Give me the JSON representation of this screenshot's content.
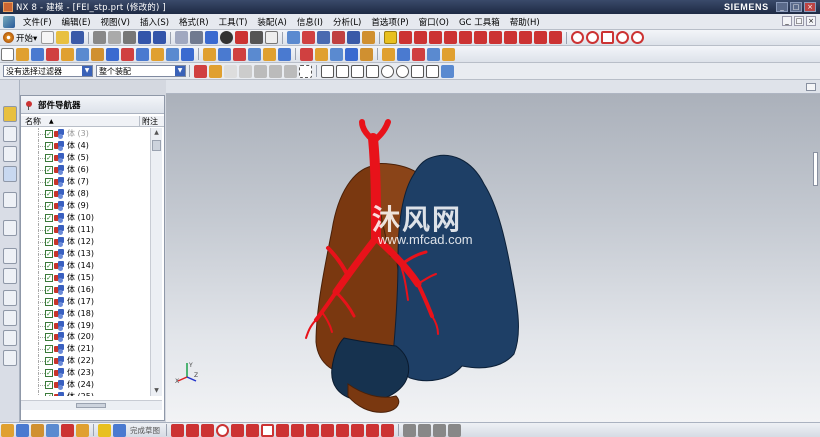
{
  "window": {
    "app_title": "NX 8 - 建模 - [FEI_stp.prt   (修改的) ]",
    "brand": "SIEMENS",
    "controls": [
      "_",
      "□",
      "×"
    ]
  },
  "menu": {
    "items": [
      "文件(F)",
      "编辑(E)",
      "视图(V)",
      "插入(S)",
      "格式(R)",
      "工具(T)",
      "装配(A)",
      "信息(I)",
      "分析(L)",
      "首选项(P)",
      "窗口(O)",
      "GC 工具箱",
      "帮助(H)"
    ],
    "right_controls": [
      "_",
      "□",
      "×"
    ]
  },
  "toolbar": {
    "start_label": "开始▾",
    "selection_filter": "没有选择过滤器",
    "assembly_scope": "整个装配",
    "status_hint": "完成草图"
  },
  "navigator": {
    "title": "部件导航器",
    "columns": {
      "name": "名称",
      "extra": "附注"
    },
    "rows": [
      {
        "label": "体 (3)",
        "dim": true
      },
      {
        "label": "体 (4)"
      },
      {
        "label": "体 (5)"
      },
      {
        "label": "体 (6)"
      },
      {
        "label": "体 (7)"
      },
      {
        "label": "体 (8)"
      },
      {
        "label": "体 (9)"
      },
      {
        "label": "体 (10)"
      },
      {
        "label": "体 (11)"
      },
      {
        "label": "体 (12)"
      },
      {
        "label": "体 (13)"
      },
      {
        "label": "体 (14)"
      },
      {
        "label": "体 (15)"
      },
      {
        "label": "体 (16)"
      },
      {
        "label": "体 (17)"
      },
      {
        "label": "体 (18)"
      },
      {
        "label": "体 (19)"
      },
      {
        "label": "体 (20)"
      },
      {
        "label": "体 (21)"
      },
      {
        "label": "体 (22)"
      },
      {
        "label": "体 (23)"
      },
      {
        "label": "体 (24)"
      },
      {
        "label": "体 (25)"
      }
    ]
  },
  "watermark": {
    "text": "沐风网",
    "url": "www.mfcad.com"
  },
  "colors": {
    "trachea": "#e8121a",
    "left_lung": "#7a3810",
    "right_lung": "#1e3f66"
  },
  "triad": {
    "x": "X",
    "y": "Y",
    "z": "Z"
  }
}
